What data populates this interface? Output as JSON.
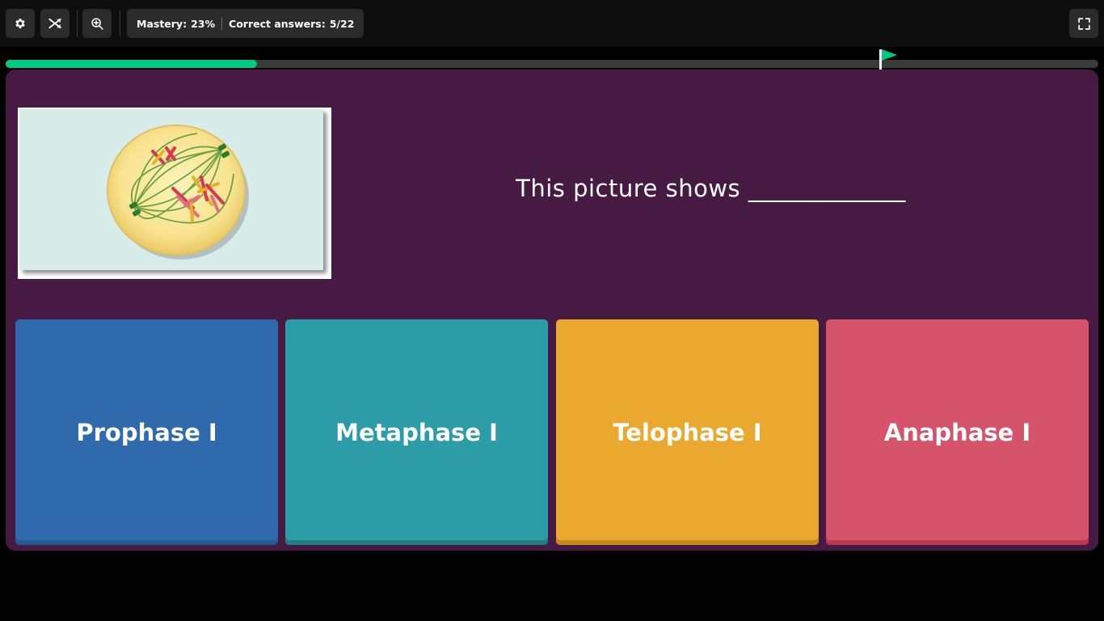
{
  "toolbar": {
    "settings_icon": "gear-icon",
    "powerup_icon": "crossed-arrows-icon",
    "zoom_icon": "zoom-in-icon",
    "fullscreen_icon": "fullscreen-icon",
    "mastery_label": "Mastery:",
    "mastery_value": "23%",
    "correct_label": "Correct answers:",
    "correct_value": "5/22"
  },
  "progress": {
    "fraction": 0.23,
    "fill_color": "#00c985",
    "flag_icon": "flag-icon",
    "flag_color": "#00c985"
  },
  "question": {
    "text": "This picture shows _____________",
    "image_icon": "cell-division-image"
  },
  "options": [
    {
      "label": "Prophase I",
      "color": "#2f6aad"
    },
    {
      "label": "Metaphase I",
      "color": "#2c9ca6"
    },
    {
      "label": "Telophase I",
      "color": "#eaa82f"
    },
    {
      "label": "Anaphase I",
      "color": "#d5546b"
    }
  ],
  "colors": {
    "panel_bg": "#461a42",
    "page_bg": "#000000"
  }
}
